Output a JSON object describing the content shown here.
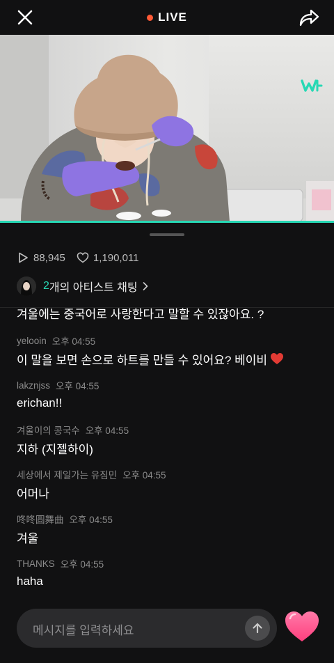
{
  "header": {
    "live_label": "LIVE",
    "close_icon": "close-icon",
    "share_icon": "share-icon",
    "live_dot_color": "#ff5a36"
  },
  "video": {
    "progress_color": "#27d8b4",
    "watermark_icon": "weverse-logo-icon"
  },
  "stats": {
    "plays": "88,945",
    "likes": "1,190,011"
  },
  "artist_chat": {
    "count": "2",
    "label": "개의 아티스트 채팅"
  },
  "chat": {
    "partial_message": "겨울에는 중국어로 사랑한다고 말할 수 있잖아요. ?",
    "messages": [
      {
        "user": "yelooin",
        "time": "오후 04:55",
        "text": "이 말을 보면 손으로 하트를 만들 수 있어요? 베이비",
        "emoji": "red-heart-emoji"
      },
      {
        "user": "lakznjss",
        "time": "오후 04:55",
        "text": "erichan!!"
      },
      {
        "user": "겨울이의 콩국수",
        "time": "오후 04:55",
        "text": "지하 (지젤하이)"
      },
      {
        "user": "세상에서 제일가는 유짐민",
        "time": "오후 04:55",
        "text": "어머나"
      },
      {
        "user": "咚咚圓舞曲",
        "time": "오후 04:55",
        "text": "겨울"
      },
      {
        "user": "THANKS",
        "time": "오후 04:55",
        "text": "haha"
      }
    ]
  },
  "composer": {
    "placeholder": "메시지를 입력하세요",
    "send_icon": "arrow-up-icon",
    "like_icon": "heart-icon",
    "like_color": "#ff4d8a"
  }
}
